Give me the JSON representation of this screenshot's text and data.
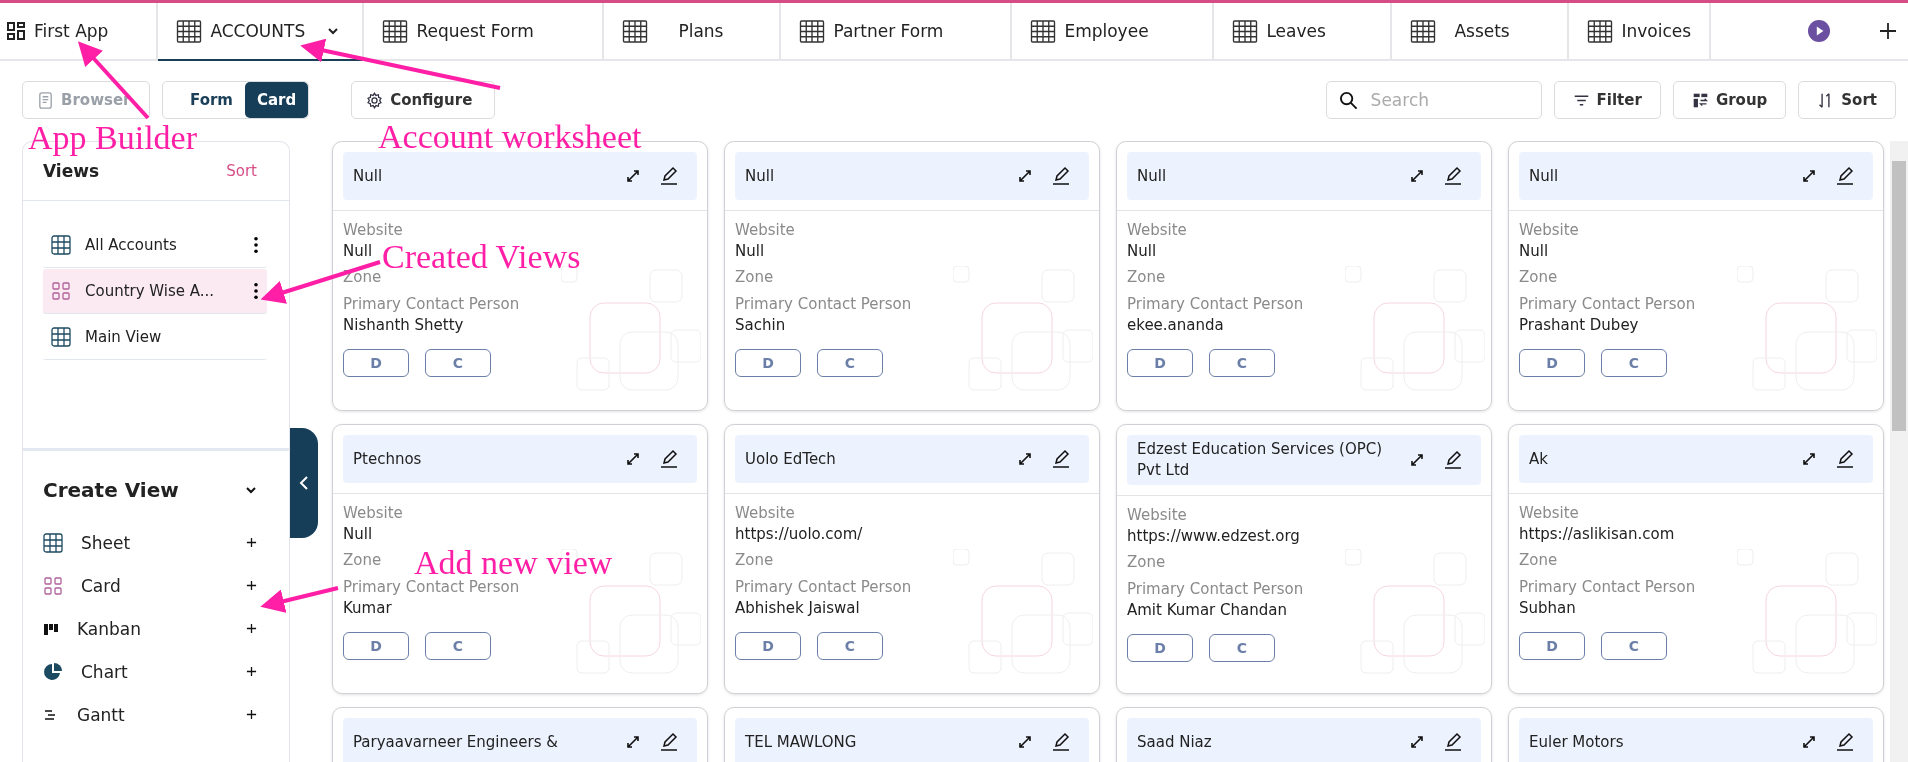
{
  "tabs": [
    {
      "label": "First App",
      "kind": "app",
      "selected": false,
      "menu": false
    },
    {
      "label": "ACCOUNTS",
      "kind": "sheet",
      "selected": true,
      "menu": true
    },
    {
      "label": "Request Form",
      "kind": "sheet",
      "selected": false,
      "menu": false
    },
    {
      "label": "Plans",
      "kind": "sheet",
      "selected": false,
      "menu": false
    },
    {
      "label": "Partner Form",
      "kind": "sheet",
      "selected": false,
      "menu": false
    },
    {
      "label": "Employee",
      "kind": "sheet",
      "selected": false,
      "menu": false
    },
    {
      "label": "Leaves",
      "kind": "sheet",
      "selected": false,
      "menu": false
    },
    {
      "label": "Assets",
      "kind": "sheet",
      "selected": false,
      "menu": false
    },
    {
      "label": "Invoices",
      "kind": "sheet",
      "selected": false,
      "menu": false
    }
  ],
  "toolbar": {
    "browser": {
      "label": "Browser",
      "disabled": true
    },
    "view_modes": [
      {
        "label": "Form",
        "selected": false
      },
      {
        "label": "Card",
        "selected": true
      }
    ],
    "configure": "Configure",
    "search": {
      "placeholder": "Search"
    },
    "filter": "Filter",
    "group": "Group",
    "sort": "Sort"
  },
  "views": {
    "title": "Views",
    "sort": "Sort",
    "items": [
      {
        "label": "All Accounts",
        "kind": "sheet",
        "selected": false,
        "menu": true
      },
      {
        "label": "Country Wise A...",
        "kind": "card",
        "selected": true,
        "menu": true
      },
      {
        "label": "Main View",
        "kind": "sheet",
        "selected": false,
        "menu": false
      }
    ]
  },
  "create_view": {
    "title": "Create View",
    "expanded": true,
    "items": [
      {
        "label": "Sheet",
        "kind": "sheet"
      },
      {
        "label": "Card",
        "kind": "card"
      },
      {
        "label": "Kanban",
        "kind": "kanban"
      },
      {
        "label": "Chart",
        "kind": "chart"
      },
      {
        "label": "Gantt",
        "kind": "gantt"
      }
    ]
  },
  "cards": [
    {
      "title": "Null",
      "fields": [
        {
          "label": "Website",
          "value": "Null"
        },
        {
          "label": "Zone"
        },
        {
          "label": "Primary Contact Person",
          "value": "Nishanth Shetty"
        }
      ],
      "actions": [
        "D",
        "C"
      ]
    },
    {
      "title": "Null",
      "fields": [
        {
          "label": "Website",
          "value": "Null"
        },
        {
          "label": "Zone"
        },
        {
          "label": "Primary Contact Person",
          "value": "Sachin"
        }
      ],
      "actions": [
        "D",
        "C"
      ]
    },
    {
      "title": "Null",
      "fields": [
        {
          "label": "Website",
          "value": "Null"
        },
        {
          "label": "Zone"
        },
        {
          "label": "Primary Contact Person",
          "value": "ekee.ananda"
        }
      ],
      "actions": [
        "D",
        "C"
      ]
    },
    {
      "title": "Null",
      "fields": [
        {
          "label": "Website",
          "value": "Null"
        },
        {
          "label": "Zone"
        },
        {
          "label": "Primary Contact Person",
          "value": "Prashant Dubey"
        }
      ],
      "actions": [
        "D",
        "C"
      ]
    },
    {
      "title": "Ptechnos",
      "fields": [
        {
          "label": "Website",
          "value": "Null"
        },
        {
          "label": "Zone"
        },
        {
          "label": "Primary Contact Person",
          "value": "Kumar"
        }
      ],
      "actions": [
        "D",
        "C"
      ]
    },
    {
      "title": "Uolo EdTech",
      "fields": [
        {
          "label": "Website",
          "value": "https://uolo.com/"
        },
        {
          "label": "Zone"
        },
        {
          "label": "Primary Contact Person",
          "value": "Abhishek Jaiswal"
        }
      ],
      "actions": [
        "D",
        "C"
      ]
    },
    {
      "title": "Edzest Education Services (OPC) Pvt Ltd",
      "fields": [
        {
          "label": "Website",
          "value": "https://www.edzest.org"
        },
        {
          "label": "Zone"
        },
        {
          "label": "Primary Contact Person",
          "value": "Amit Kumar Chandan"
        }
      ],
      "actions": [
        "D",
        "C"
      ]
    },
    {
      "title": "Ak",
      "fields": [
        {
          "label": "Website",
          "value": "https://aslikisan.com"
        },
        {
          "label": "Zone"
        },
        {
          "label": "Primary Contact Person",
          "value": "Subhan"
        }
      ],
      "actions": [
        "D",
        "C"
      ]
    },
    {
      "title": "Paryaavarneer Engineers &"
    },
    {
      "title": "TEL MAWLONG"
    },
    {
      "title": "Saad Niaz"
    },
    {
      "title": "Euler Motors"
    }
  ],
  "annotations": [
    {
      "text": "App Builder"
    },
    {
      "text": "Account worksheet"
    },
    {
      "text": "Created Views"
    },
    {
      "text": "Add new view"
    }
  ]
}
